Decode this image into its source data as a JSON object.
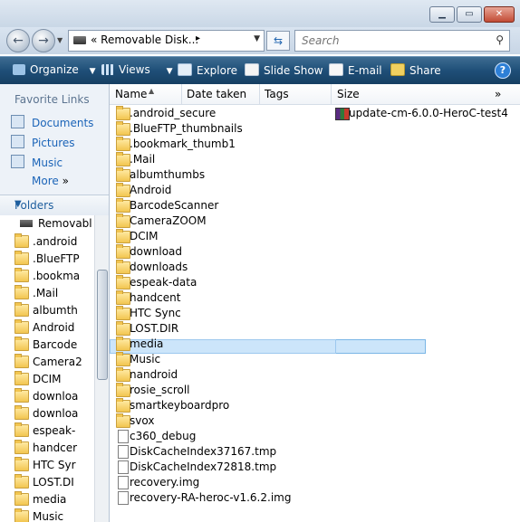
{
  "window": {
    "buttons": [
      "minimize",
      "maximize",
      "close"
    ]
  },
  "address": {
    "path_prefix": "«",
    "path": "Removable Disk...",
    "crumb_arrow": "▸",
    "search_placeholder": "Search"
  },
  "toolbar": {
    "items": [
      {
        "label": "Organize",
        "icon": "organize-icon",
        "dropdown": true
      },
      {
        "label": "Views",
        "icon": "views-icon",
        "dropdown": true
      },
      {
        "label": "Explore",
        "icon": "explore-icon"
      },
      {
        "label": "Slide Show",
        "icon": "slideshow-icon"
      },
      {
        "label": "E-mail",
        "icon": "email-icon"
      },
      {
        "label": "Share",
        "icon": "share-icon"
      }
    ],
    "help": "?"
  },
  "favorites": {
    "heading": "Favorite Links",
    "items": [
      "Documents",
      "Pictures",
      "Music"
    ],
    "more": "More",
    "more_arrows": "»"
  },
  "folders_pane": {
    "heading": "Folders",
    "root": "Removabl",
    "items": [
      ".android",
      ".BlueFTP",
      ".bookma",
      ".Mail",
      "albumth",
      "Android",
      "Barcode",
      "Camera2",
      "DCIM",
      "downloa",
      "downloa",
      "espeak-",
      "handcer",
      "HTC Syr",
      "LOST.DI",
      "media",
      "Music"
    ]
  },
  "columns": {
    "name": "Name",
    "date": "Date taken",
    "tags": "Tags",
    "size": "Size",
    "more": "»"
  },
  "files": [
    {
      "name": ".android_secure",
      "type": "folder"
    },
    {
      "name": ".BlueFTP_thumbnails",
      "type": "folder"
    },
    {
      "name": ".bookmark_thumb1",
      "type": "folder"
    },
    {
      "name": ".Mail",
      "type": "folder"
    },
    {
      "name": "albumthumbs",
      "type": "folder"
    },
    {
      "name": "Android",
      "type": "folder"
    },
    {
      "name": "BarcodeScanner",
      "type": "folder"
    },
    {
      "name": "CameraZOOM",
      "type": "folder"
    },
    {
      "name": "DCIM",
      "type": "folder"
    },
    {
      "name": "download",
      "type": "folder"
    },
    {
      "name": "downloads",
      "type": "folder"
    },
    {
      "name": "espeak-data",
      "type": "folder"
    },
    {
      "name": "handcent",
      "type": "folder"
    },
    {
      "name": "HTC Sync",
      "type": "folder"
    },
    {
      "name": "LOST.DIR",
      "type": "folder"
    },
    {
      "name": "media",
      "type": "folder",
      "selected": true
    },
    {
      "name": "Music",
      "type": "folder"
    },
    {
      "name": "nandroid",
      "type": "folder"
    },
    {
      "name": "rosie_scroll",
      "type": "folder"
    },
    {
      "name": "smartkeyboardpro",
      "type": "folder"
    },
    {
      "name": "svox",
      "type": "folder"
    },
    {
      "name": "c360_debug",
      "type": "file"
    },
    {
      "name": "DiskCacheIndex37167.tmp",
      "type": "file"
    },
    {
      "name": "DiskCacheIndex72818.tmp",
      "type": "file"
    },
    {
      "name": "recovery.img",
      "type": "file"
    },
    {
      "name": "recovery-RA-heroc-v1.6.2.img",
      "type": "file"
    }
  ],
  "files_col2": [
    {
      "name": "update-cm-6.0.0-HeroC-test4",
      "type": "rar"
    }
  ]
}
